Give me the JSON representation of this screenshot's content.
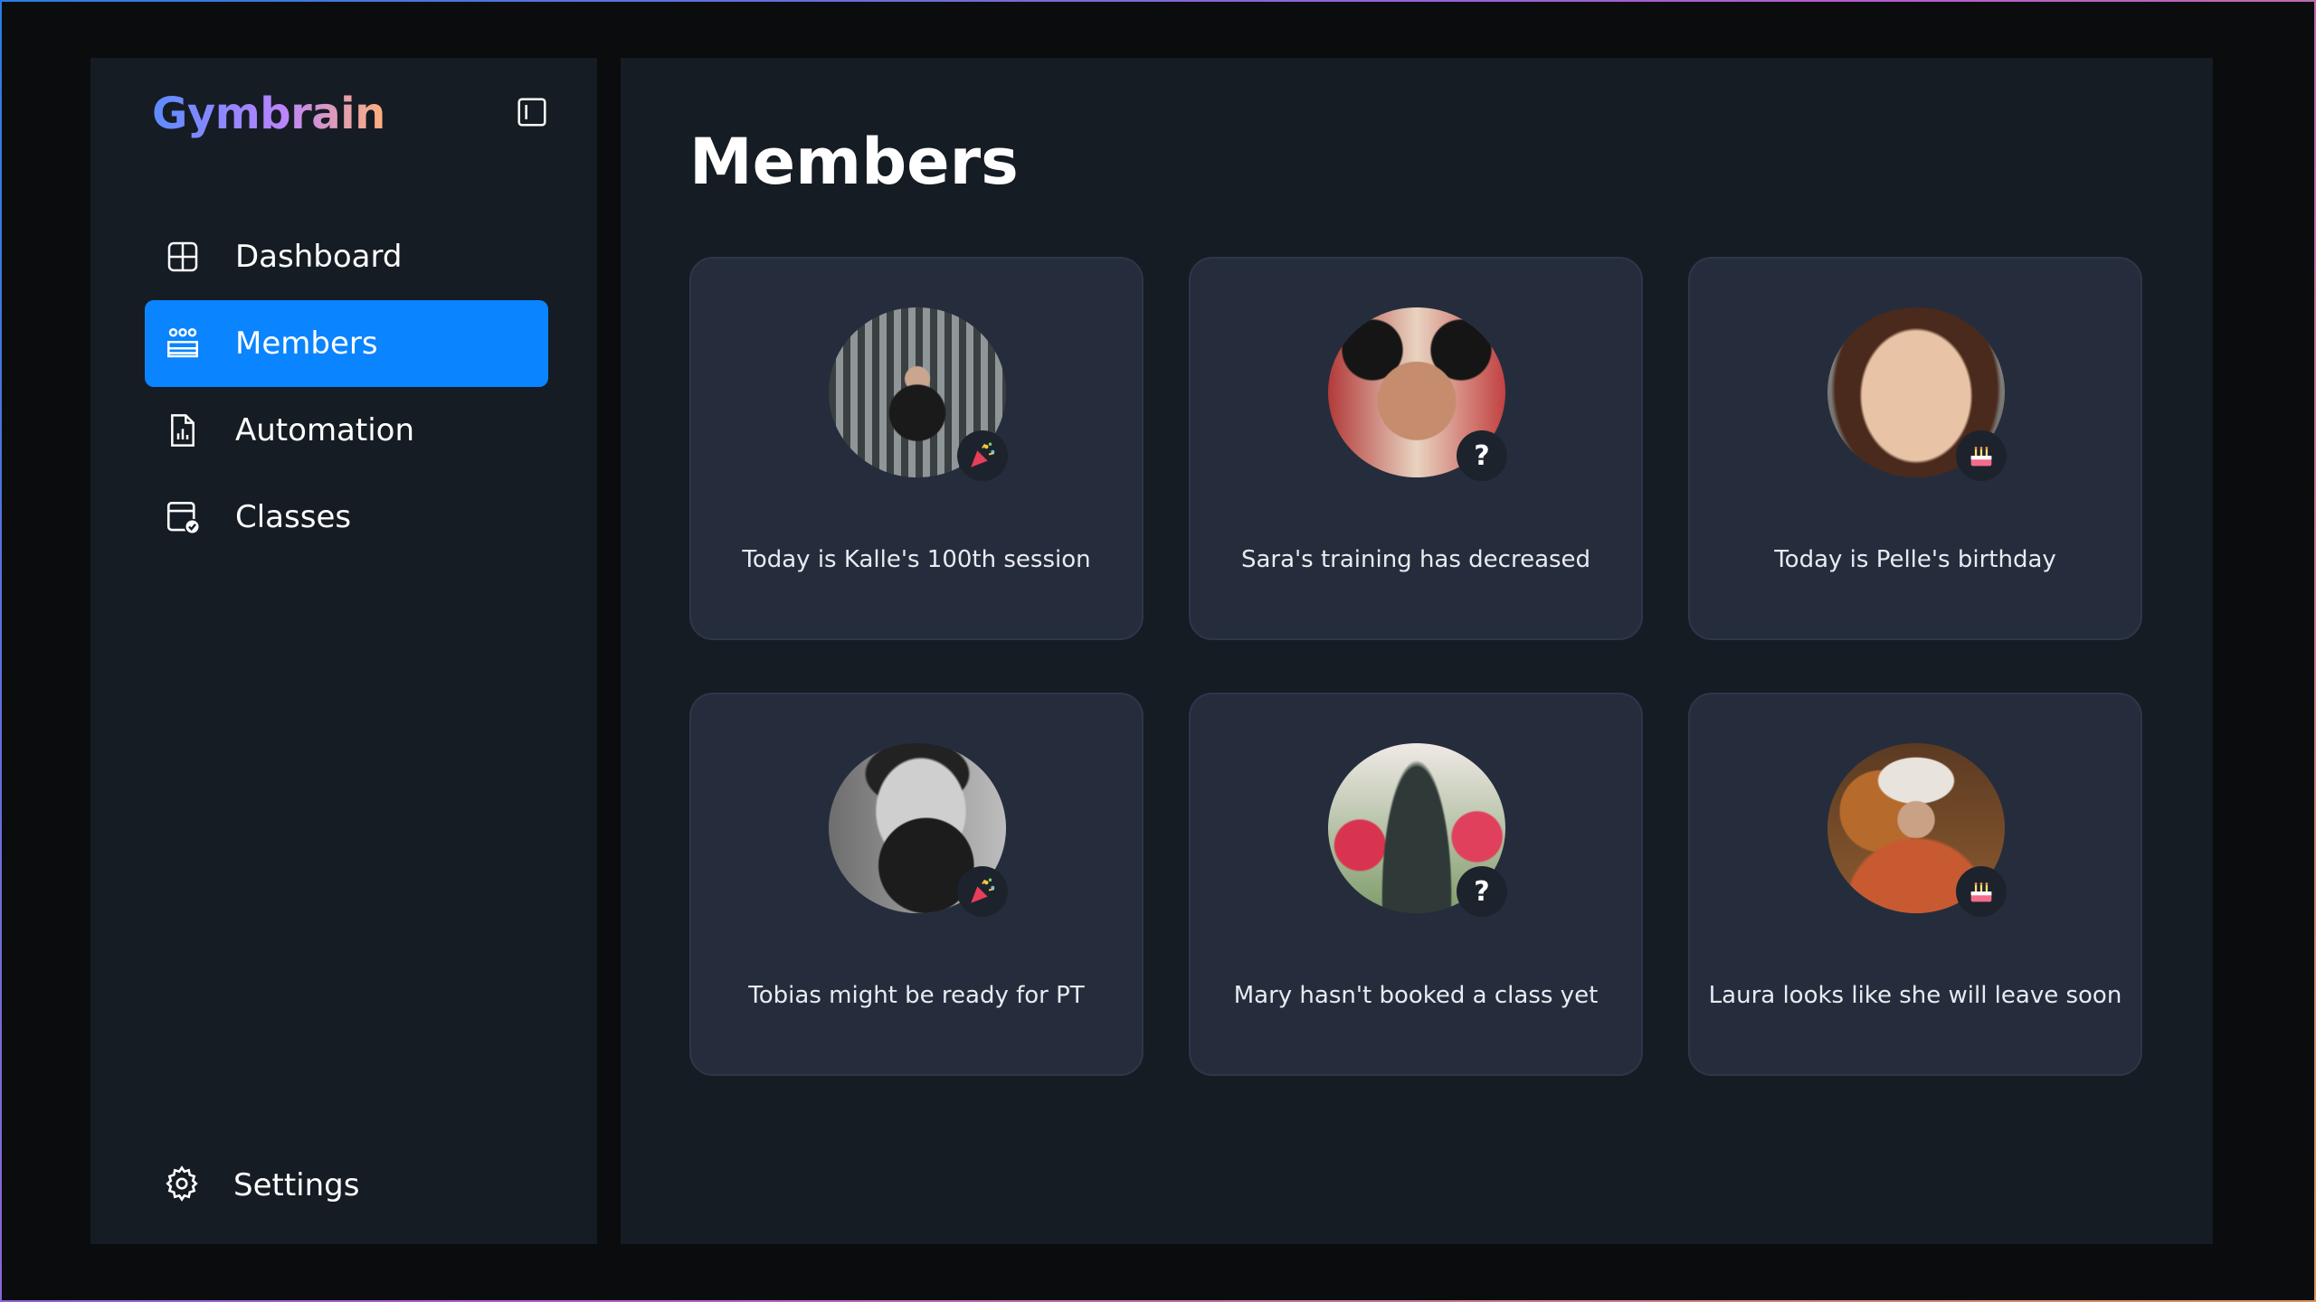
{
  "app": {
    "name": "Gymbrain"
  },
  "sidebar": {
    "items": [
      {
        "label": "Dashboard",
        "icon": "grid-icon",
        "active": false
      },
      {
        "label": "Members",
        "icon": "members-icon",
        "active": true
      },
      {
        "label": "Automation",
        "icon": "report-icon",
        "active": false
      },
      {
        "label": "Classes",
        "icon": "calendar-check-icon",
        "active": false
      }
    ],
    "settings_label": "Settings"
  },
  "main": {
    "title": "Members",
    "cards": [
      {
        "text": "Today is Kalle's 100th session",
        "badge": "party-popper-icon"
      },
      {
        "text": "Sara's training has decreased",
        "badge": "question-icon",
        "badge_text": "?"
      },
      {
        "text": "Today is Pelle's birthday",
        "badge": "birthday-cake-icon"
      },
      {
        "text": "Tobias might be ready for PT",
        "badge": "party-popper-icon"
      },
      {
        "text": "Mary hasn't booked a class yet",
        "badge": "question-icon",
        "badge_text": "?"
      },
      {
        "text": "Laura looks like she will leave soon",
        "badge": "birthday-cake-icon"
      }
    ]
  },
  "colors": {
    "accent": "#0a84ff",
    "panel": "#161c24",
    "card": "#252d3d",
    "background": "#0a0c0e"
  }
}
